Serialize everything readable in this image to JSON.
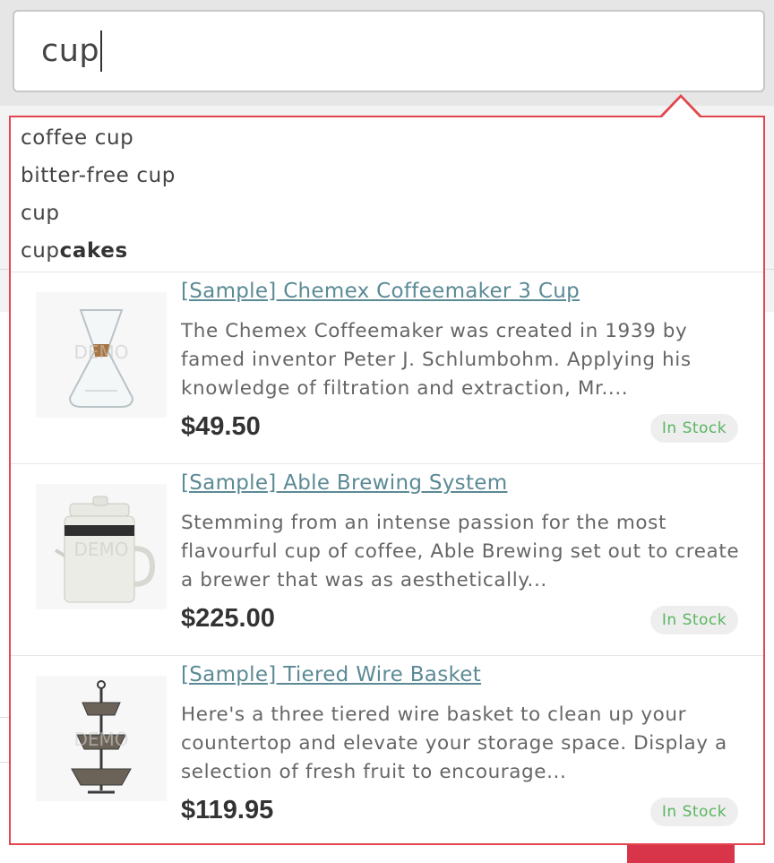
{
  "search": {
    "value": "cup"
  },
  "suggestions": [
    {
      "prefix": "coffee cup",
      "bold": ""
    },
    {
      "prefix": "bitter-free cup",
      "bold": ""
    },
    {
      "prefix": "cup",
      "bold": ""
    },
    {
      "prefix": "cup",
      "bold": "cakes"
    }
  ],
  "products": [
    {
      "title": "[Sample] Chemex Coffeemaker 3 Cup",
      "description": "The Chemex Coffeemaker was created in 1939 by famed inventor Peter J. Schlumbohm. Applying his knowledge of filtration and extraction, Mr....",
      "price": "$49.50",
      "stock": "In Stock",
      "watermark": "DEMO"
    },
    {
      "title": "[Sample] Able Brewing System",
      "description": "Stemming from an intense passion for the most flavourful cup of coffee, Able Brewing set out to create a brewer that was as aesthetically...",
      "price": "$225.00",
      "stock": "In Stock",
      "watermark": "DEMO"
    },
    {
      "title": "[Sample] Tiered Wire Basket",
      "description": "Here's a three tiered wire basket to clean up your countertop and elevate your storage space. Display a selection of fresh fruit to encourage...",
      "price": "$119.95",
      "stock": "In Stock",
      "watermark": "DEMO"
    }
  ],
  "colors": {
    "accent_border": "#e2474f",
    "link": "#5b8a95",
    "in_stock": "#5bb560"
  }
}
